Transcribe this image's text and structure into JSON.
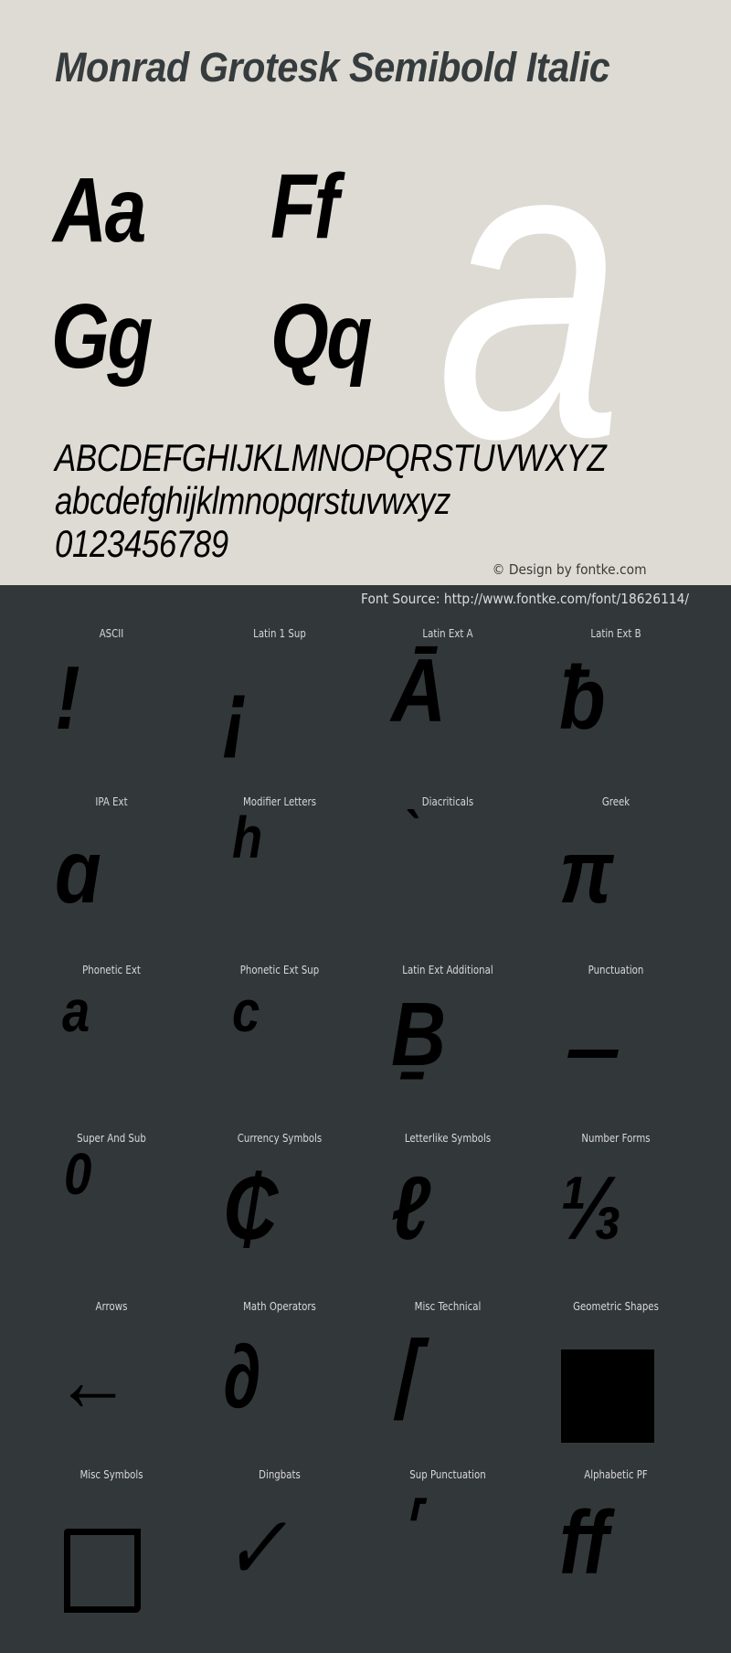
{
  "header": {
    "title": "Monrad Grotesk Semibold Italic"
  },
  "specimen": {
    "pairs": [
      "Aa",
      "Ff",
      "Gg",
      "Qq"
    ],
    "hero_glyph": "a",
    "uppercase": "ABCDEFGHIJKLMNOPQRSTUVWXYZ",
    "lowercase": "abcdefghijklmnopqrstuvwxyz",
    "digits": "0123456789",
    "credit": "© Design by fontke.com"
  },
  "source": {
    "text": "Font Source: http://www.fontke.com/font/18626114/"
  },
  "colors": {
    "top_background": "#dddbd3",
    "bottom_background": "#32383a",
    "title_color": "#363c3e",
    "hero_glyph_color": "#ffffff",
    "label_color": "#d8d8d8",
    "glyph_color": "#000000"
  },
  "blocks": [
    {
      "label": "ASCII",
      "glyph": "!",
      "icon": "exclamation-glyph"
    },
    {
      "label": "Latin 1 Sup",
      "glyph": "¡",
      "icon": "inverted-exclamation-glyph"
    },
    {
      "label": "Latin Ext A",
      "glyph": "Ā",
      "icon": "a-macron-glyph"
    },
    {
      "label": "Latin Ext B",
      "glyph": "ƀ",
      "icon": "b-stroke-glyph"
    },
    {
      "label": "IPA Ext",
      "glyph": "ɑ",
      "icon": "alpha-latin-glyph"
    },
    {
      "label": "Modifier Letters",
      "glyph": "ʰ",
      "icon": "modifier-h-glyph"
    },
    {
      "label": "Diacriticals",
      "glyph": "̀",
      "icon": "grave-accent-glyph"
    },
    {
      "label": "Greek",
      "glyph": "π",
      "icon": "pi-glyph"
    },
    {
      "label": "Phonetic Ext",
      "glyph": "ᵃ",
      "icon": "superscript-a-glyph"
    },
    {
      "label": "Phonetic Ext Sup",
      "glyph": "ᶜ",
      "icon": "superscript-c-glyph"
    },
    {
      "label": "Latin Ext Additional",
      "glyph": "Ḇ",
      "icon": "b-macron-below-glyph"
    },
    {
      "label": "Punctuation",
      "glyph": "–",
      "icon": "en-dash-glyph"
    },
    {
      "label": "Super And Sub",
      "glyph": "⁰",
      "icon": "superscript-zero-glyph"
    },
    {
      "label": "Currency Symbols",
      "glyph": "₵",
      "icon": "cedi-glyph"
    },
    {
      "label": "Letterlike Symbols",
      "glyph": "ℓ",
      "icon": "script-l-glyph"
    },
    {
      "label": "Number Forms",
      "glyph": "⅓",
      "icon": "one-third-glyph"
    },
    {
      "label": "Arrows",
      "glyph": "←",
      "icon": "left-arrow-glyph"
    },
    {
      "label": "Math Operators",
      "glyph": "∂",
      "icon": "partial-differential-glyph"
    },
    {
      "label": "Misc Technical",
      "glyph": "⌈",
      "icon": "left-ceiling-glyph"
    },
    {
      "label": "Geometric Shapes",
      "glyph": "■",
      "icon": "black-square-glyph"
    },
    {
      "label": "Misc Symbols",
      "glyph": "□",
      "icon": "hollow-square-glyph"
    },
    {
      "label": "Dingbats",
      "glyph": "✓",
      "icon": "check-mark-glyph"
    },
    {
      "label": "Sup Punctuation",
      "glyph": "⸢",
      "icon": "top-left-half-bracket-glyph"
    },
    {
      "label": "Alphabetic PF",
      "glyph": "ﬀ",
      "icon": "ff-ligature-glyph"
    }
  ]
}
